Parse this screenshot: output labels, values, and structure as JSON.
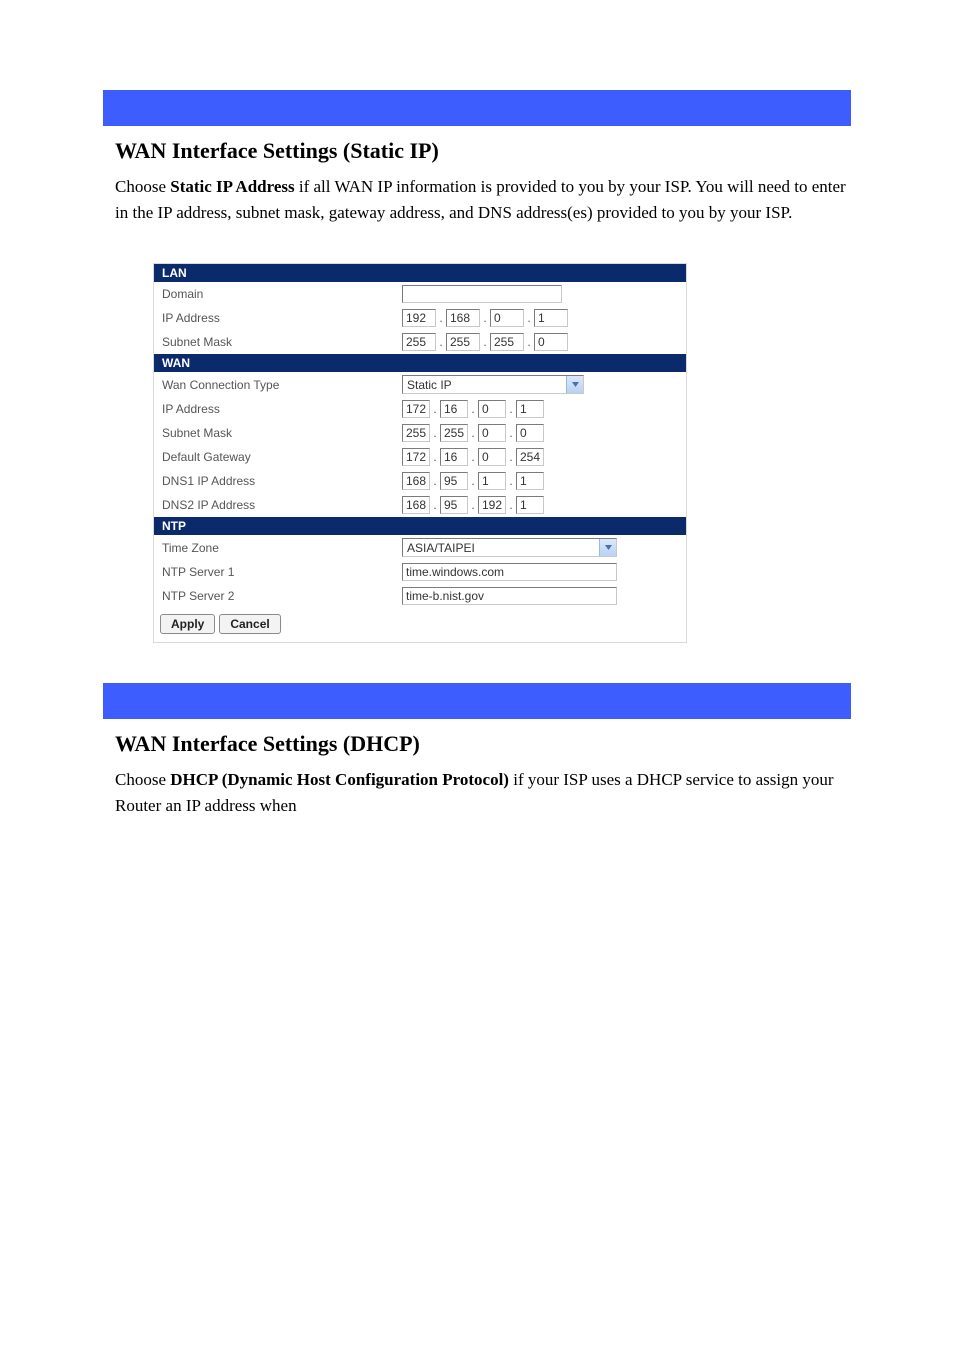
{
  "section1": {
    "title": "WAN Interface Settings (Static IP)",
    "intro_prefix": "Choose ",
    "intro_strong": "Static IP Address",
    "intro_suffix": " if all WAN IP information is provided to you by your ISP. You will need to enter in the IP address, subnet mask, gateway address, and DNS address(es) provided to you by your ISP."
  },
  "panel": {
    "lan": {
      "header": "LAN",
      "domain_label": "Domain",
      "domain_value": "",
      "ip_label": "IP Address",
      "ip": [
        "192",
        "168",
        "0",
        "1"
      ],
      "mask_label": "Subnet Mask",
      "mask": [
        "255",
        "255",
        "255",
        "0"
      ]
    },
    "wan": {
      "header": "WAN",
      "conn_label": "Wan Connection Type",
      "conn_value": "Static IP",
      "ip_label": "IP Address",
      "ip": [
        "172",
        "16",
        "0",
        "1"
      ],
      "mask_label": "Subnet Mask",
      "mask": [
        "255",
        "255",
        "0",
        "0"
      ],
      "gw_label": "Default Gateway",
      "gw": [
        "172",
        "16",
        "0",
        "254"
      ],
      "dns1_label": "DNS1 IP Address",
      "dns1": [
        "168",
        "95",
        "1",
        "1"
      ],
      "dns2_label": "DNS2 IP Address",
      "dns2": [
        "168",
        "95",
        "192",
        "1"
      ]
    },
    "ntp": {
      "header": "NTP",
      "tz_label": "Time Zone",
      "tz_value": "ASIA/TAIPEI",
      "s1_label": "NTP Server 1",
      "s1_value": "time.windows.com",
      "s2_label": "NTP Server 2",
      "s2_value": "time-b.nist.gov"
    },
    "buttons": {
      "apply": "Apply",
      "cancel": "Cancel"
    }
  },
  "section2": {
    "title": "WAN Interface Settings (DHCP)",
    "intro_prefix": "Choose ",
    "intro_strong": "DHCP (Dynamic Host Configuration Protocol)",
    "intro_suffix": " if your ISP uses a DHCP service to assign your Router an IP address when"
  }
}
